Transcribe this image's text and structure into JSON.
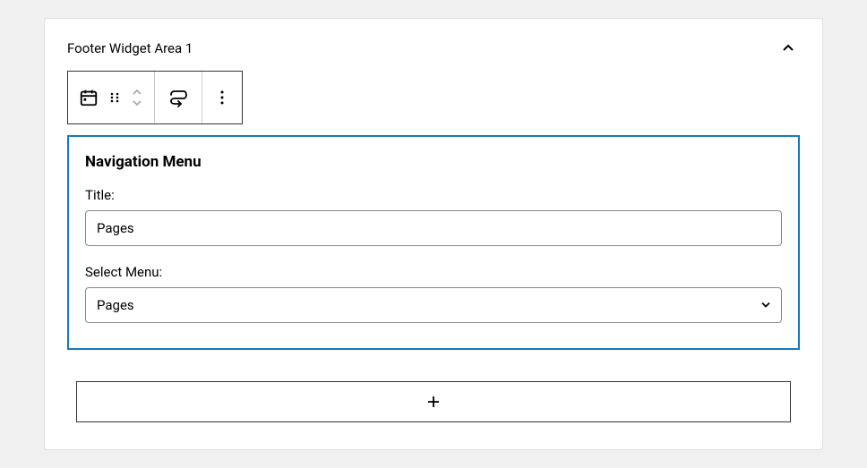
{
  "widgetArea": {
    "title": "Footer Widget Area 1"
  },
  "widget": {
    "name": "Navigation Menu",
    "titleLabel": "Title:",
    "titleValue": "Pages",
    "selectLabel": "Select Menu:",
    "selectValue": "Pages"
  }
}
